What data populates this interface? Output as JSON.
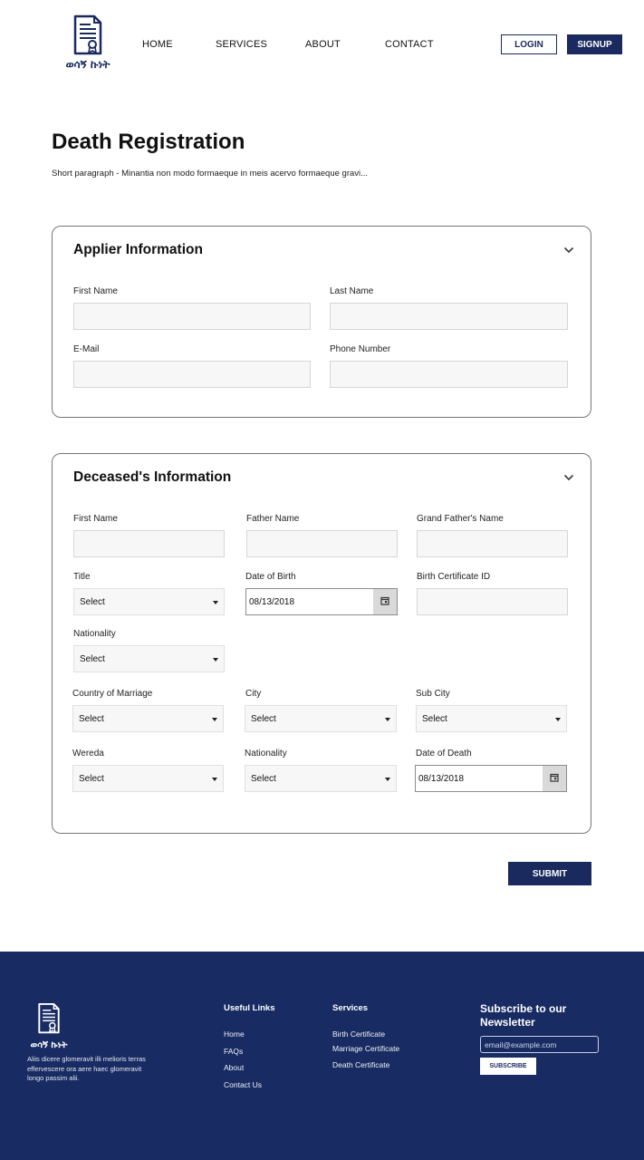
{
  "header": {
    "logo_text": "ወሳኝ ኩነት",
    "nav": [
      "HOME",
      "SERVICES",
      "ABOUT",
      "CONTACT"
    ],
    "login_label": "LOGIN",
    "signup_label": "SIGNUP"
  },
  "page": {
    "title": "Death Registration",
    "intro": "Short paragraph - Minantia non modo formaeque in meis acervo formaeque gravi..."
  },
  "applier": {
    "title": "Applier Information",
    "first_name_label": "First Name",
    "last_name_label": "Last Name",
    "email_label": "E-Mail",
    "phone_label": "Phone Number"
  },
  "deceased": {
    "title": "Deceased's Information",
    "first_name_label": "First Name",
    "father_name_label": "Father Name",
    "grandfather_label": "Grand Father's Name",
    "title_label": "Title",
    "title_value": "Select",
    "dob_label": "Date of Birth",
    "dob_value": "08/13/2018",
    "birth_cert_label": "Birth Certificate ID",
    "nationality_label": "Nationality",
    "nationality_value": "Select",
    "country_marriage_label": "Country of Marriage",
    "country_marriage_value": "Select",
    "city_label": "City",
    "city_value": "Select",
    "subcity_label": "Sub City",
    "subcity_value": "Select",
    "wereda_label": "Wereda",
    "wereda_value": "Select",
    "nationality2_label": "Nationality",
    "nationality2_value": "Select",
    "dod_label": "Date of Death",
    "dod_value": "08/13/2018"
  },
  "submit_label": "SUBMIT",
  "footer": {
    "logo_text": "ወሳኝ ኩነት",
    "description": "Aliis dicere glomeravit illi melioris terras effervescere ora aere haec glomeravit longo passim alii.",
    "useful_links_title": "Useful Links",
    "useful_links": [
      "Home",
      "FAQs",
      "About",
      "Contact Us"
    ],
    "services_title": "Services",
    "services": [
      "Birth Certificate",
      "Marriage Certificate",
      "Death Certificate"
    ],
    "newsletter_title": "Subscribe to our Newsletter",
    "email_placeholder": "email@example.com",
    "subscribe_label": "SUBSCRIBE"
  },
  "colors": {
    "brand_navy": "#1a2a5e",
    "footer_bg": "#182b63"
  },
  "icons": [
    "certificate-document-icon",
    "chevron-down-icon",
    "calendar-icon",
    "caret-down-icon"
  ]
}
